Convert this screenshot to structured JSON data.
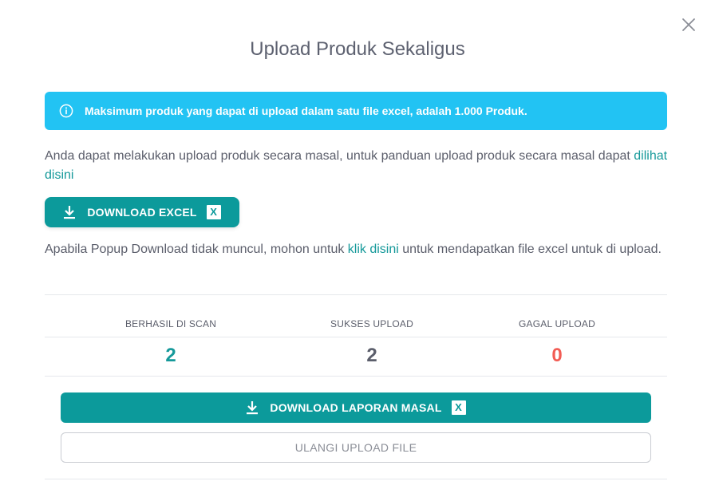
{
  "modal": {
    "title": "Upload Produk Sekaligus",
    "close_icon": "close-icon"
  },
  "alert": {
    "icon": "info-icon",
    "text": "Maksimum produk yang dapat di upload dalam satu file excel, adalah 1.000 Produk.",
    "color": "#22c3f3"
  },
  "guide": {
    "text_before": "Anda dapat melakukan upload produk secara masal, untuk panduan upload produk secara masal dapat ",
    "link": "dilihat disini"
  },
  "download_excel": {
    "icon": "download-icon",
    "label": "DOWNLOAD EXCEL",
    "badge": "X"
  },
  "popup_note": {
    "text_before": "Apabila Popup Download tidak muncul, mohon untuk ",
    "link": "klik disini",
    "text_after": " untuk mendapatkan file excel untuk di upload."
  },
  "stats": [
    {
      "label": "BERHASIL DI SCAN",
      "value": "2",
      "color": "#15999a"
    },
    {
      "label": "SUKSES UPLOAD",
      "value": "2",
      "color": "#5b5e6b"
    },
    {
      "label": "GAGAL UPLOAD",
      "value": "0",
      "color": "#f25c54"
    }
  ],
  "download_report": {
    "icon": "download-icon",
    "label": "DOWNLOAD LAPORAN MASAL",
    "badge": "X"
  },
  "retry_button": {
    "label": "ULANGI UPLOAD FILE"
  },
  "colors": {
    "primary": "#0c9a9b",
    "link": "#15999a",
    "danger": "#f25c54"
  }
}
